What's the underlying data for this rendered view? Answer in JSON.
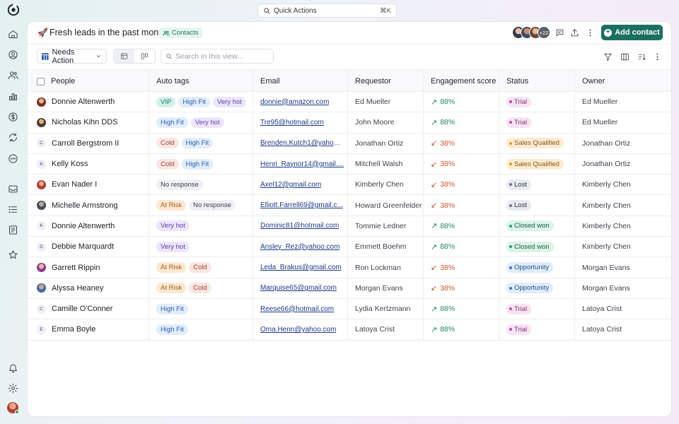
{
  "quick_actions": {
    "label": "Quick Actions",
    "shortcut": "⌘K"
  },
  "sidebar": {
    "nav": [
      "home-icon",
      "user-circle-icon",
      "users-icon",
      "chart-icon",
      "dollar-icon",
      "sync-icon",
      "more-circle-icon",
      "inbox-icon",
      "list-icon",
      "document-icon",
      "star-icon"
    ],
    "bottom": [
      "bell-icon",
      "settings-icon"
    ]
  },
  "header": {
    "title": "Fresh leads in the past month",
    "emoji": "🚀",
    "chip": "Contacts",
    "avatar_more": "+22",
    "add_button": "Add contact",
    "accent": "#1b6f60"
  },
  "toolbar": {
    "view_name": "Needs Action",
    "search_placeholder": "Search in this view..."
  },
  "table": {
    "columns": [
      "People",
      "Auto tags",
      "Email",
      "Requestor",
      "Engagement score",
      "Status",
      "Owner"
    ],
    "rows": [
      {
        "name": "Donnie Altenwerth",
        "avatar": "photo",
        "tags": [
          "VIP",
          "High Fit",
          "Very hot"
        ],
        "email": "donnie@amazon.com",
        "requestor": "Ed Mueller",
        "trend": "up",
        "score": "88%",
        "status": "Trial",
        "owner": "Ed Mueller"
      },
      {
        "name": "Nicholas Kihn DDS",
        "avatar": "photo",
        "tags": [
          "High Fit",
          "Very hot"
        ],
        "email": "Tre95@hotmail.com",
        "requestor": "John Moore",
        "trend": "up",
        "score": "88%",
        "status": "Trial",
        "owner": "Ed Mueller"
      },
      {
        "name": "Carroll Bergstrom II",
        "avatar": "C",
        "tags": [
          "Cold",
          "High Fit"
        ],
        "email": "Brenden.Kutch1@yahoo.co...",
        "requestor": "Jonathan Ortiz",
        "trend": "down",
        "score": "38%",
        "status": "Sales Qualified",
        "owner": "Jonathan Ortiz"
      },
      {
        "name": "Kelly Koss",
        "avatar": "K",
        "tags": [
          "Cold",
          "High Fit"
        ],
        "email": "Henri_Raynor14@gmail....",
        "requestor": "Mitchell Walsh",
        "trend": "down",
        "score": "38%",
        "status": "Sales Qualified",
        "owner": "Jonathan Ortiz"
      },
      {
        "name": "Evan Nader I",
        "avatar": "photo",
        "tags": [
          "No response"
        ],
        "email": "Axel12@gmail.com",
        "requestor": "Kimberly Chen",
        "trend": "down",
        "score": "38%",
        "status": "Lost",
        "owner": "Kimberly Chen"
      },
      {
        "name": "Michelle Armstrong",
        "avatar": "photo",
        "tags": [
          "At Risk",
          "No response"
        ],
        "email": "Elliott.Farrell69@gmail.c...",
        "requestor": "Howard Greenfelder",
        "trend": "down",
        "score": "38%",
        "status": "Lost",
        "owner": "Kimberly Chen"
      },
      {
        "name": "Donnie Altenwerth",
        "avatar": "K",
        "tags": [
          "Very hot"
        ],
        "email": "Dominic81@hotmail.com",
        "requestor": "Tommie Ledner",
        "trend": "up",
        "score": "88%",
        "status": "Closed won",
        "owner": "Kimberly Chen"
      },
      {
        "name": "Debbie Marquardt",
        "avatar": "D",
        "tags": [
          "Very hot"
        ],
        "email": "Ansley_Rez@yahoo.com",
        "requestor": "Emmett Boehm",
        "trend": "up",
        "score": "88%",
        "status": "Closed won",
        "owner": "Kimberly Chen"
      },
      {
        "name": "Garrett Rippin",
        "avatar": "photo",
        "tags": [
          "At Risk",
          "Cold"
        ],
        "email": "Leda_Brakus@gmail.com",
        "requestor": "Ron Lockman",
        "trend": "down",
        "score": "38%",
        "status": "Opportunity",
        "owner": "Morgan Evans"
      },
      {
        "name": "Alyssa Heaney",
        "avatar": "photo",
        "tags": [
          "At Risk",
          "Cold"
        ],
        "email": "Marquise65@gmail.com",
        "requestor": "Morgan Evans",
        "trend": "down",
        "score": "38%",
        "status": "Opportunity",
        "owner": "Morgan Evans"
      },
      {
        "name": "Camille O'Conner",
        "avatar": "C",
        "tags": [
          "High Fit"
        ],
        "email": "Reese66@hotmail.com",
        "requestor": "Lydia Kertzmann",
        "trend": "up",
        "score": "88%",
        "status": "Trial",
        "owner": "Latoya Crist"
      },
      {
        "name": "Emma Boyle",
        "avatar": "E",
        "tags": [
          "High Fit"
        ],
        "email": "Oma.Henn@yahoo.com",
        "requestor": "Latoya Crist",
        "trend": "up",
        "score": "88%",
        "status": "Trial",
        "owner": "Latoya Crist"
      }
    ]
  },
  "tag_colors": {
    "VIP": {
      "bg": "#d4f1ea",
      "fg": "#137560"
    },
    "High Fit": {
      "bg": "#e2edfb",
      "fg": "#2a5ea8"
    },
    "Very hot": {
      "bg": "#ece6fb",
      "fg": "#5b3fa8"
    },
    "Cold": {
      "bg": "#fbe6e2",
      "fg": "#a8402c"
    },
    "No response": {
      "bg": "#eef0f3",
      "fg": "#3d434b"
    },
    "At Risk": {
      "bg": "#fde9d3",
      "fg": "#a85a14"
    }
  },
  "status_colors": {
    "Trial": {
      "bg": "#f6e4f3",
      "fg": "#8a2f7c",
      "dot": "#c04aa9"
    },
    "Sales Qualified": {
      "bg": "#fdebd2",
      "fg": "#8a5413",
      "dot": "#e39a2b"
    },
    "Lost": {
      "bg": "#e8ebf1",
      "fg": "#2f3540",
      "dot": "#6b7380"
    },
    "Closed won": {
      "bg": "#dcf3e8",
      "fg": "#17603f",
      "dot": "#23a469"
    },
    "Opportunity": {
      "bg": "#e0ecfb",
      "fg": "#1f4f8f",
      "dot": "#3479d6"
    }
  },
  "trend_colors": {
    "up": "#1f8a5e",
    "down": "#d4532b"
  }
}
